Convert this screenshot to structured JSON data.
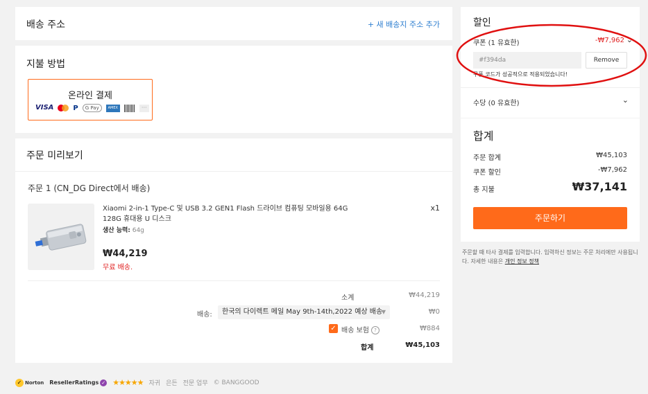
{
  "address": {
    "title": "배송 주소",
    "add_link": "+ 새 배송지 주소 추가"
  },
  "payment": {
    "title": "지불 방법",
    "method_label": "온라인 결제",
    "logos": [
      "VISA",
      "mastercard-icon",
      "P",
      "G Pay",
      "AMERICAN EXPRESS",
      "barcode-icon",
      "···"
    ]
  },
  "preview": {
    "title": "주문 미리보기",
    "order_label": "주문 1 (CN_DG Direct에서 배송)",
    "item": {
      "name": "Xiaomi 2-in-1 Type-C 및 USB 3.2 GEN1 Flash 드라이브 컴퓨팅 모바일용 64G 128G 휴대용 U 디스크",
      "spec_label": "생산 능력:",
      "spec_value": "64g",
      "qty": "x1",
      "price": "₩44,219",
      "shipping": "무료 배송."
    },
    "subtotal_label": "소계",
    "subtotal_value": "₩44,219",
    "ship_label": "배송:",
    "ship_option": "한국의 다이렉트 메일 May 9th-14th,2022 예상 배송",
    "ship_value": "₩0",
    "insurance_label": "배송 보험",
    "insurance_value": "₩884",
    "total_label": "합계",
    "total_value": "₩45,103"
  },
  "discount": {
    "title": "할인",
    "coupon_label": "쿠폰 (1 유효한)",
    "coupon_value": "-₩7,962",
    "code": "#f394da",
    "remove_label": "Remove",
    "success_msg": "쿠폰 코드가 성공적으로 적용되었습니다!",
    "fee_label": "수당 (0 유효한)"
  },
  "total": {
    "title": "합계",
    "order_total_label": "주문 합계",
    "order_total_value": "₩45,103",
    "coupon_discount_label": "쿠폰 할인",
    "coupon_discount_value": "-₩7,962",
    "pay_label": "총 지불",
    "pay_value": "₩37,141",
    "order_button": "주문하기"
  },
  "note": {
    "text": "주문할 때 타사 결제를 입력합니다. 입력하신 정보는 주문 처리에만 사용됩니다. 자세한 내용은 ",
    "link": "개인 정보 정책"
  },
  "footer": {
    "norton": "Norton",
    "reseller": "ResellerRatings",
    "stars": "★★★★★",
    "links": [
      "자귀",
      "은든",
      "전문 업무"
    ],
    "copyright": "© BANGGOOD"
  },
  "colors": {
    "accent": "#ff6a1a",
    "annotation": "#e01010",
    "discount": "#e02020",
    "link": "#2f7fd0"
  }
}
